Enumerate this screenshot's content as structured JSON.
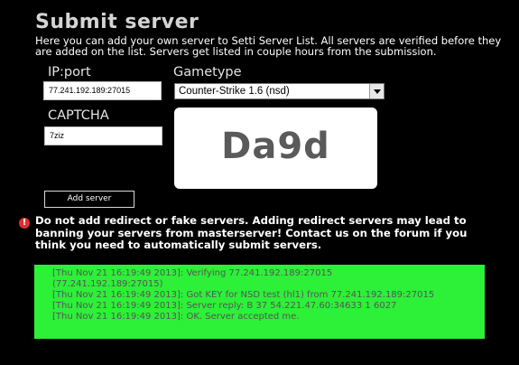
{
  "page": {
    "title": "Submit server",
    "intro": "Here you can add your own server to Setti Server List. All servers are verified before they are added on the list. Servers get listed in couple hours from the submission."
  },
  "form": {
    "ip_label": "IP:port",
    "ip_value": "77.241.192.189:27015",
    "gametype_label": "Gametype",
    "gametype_value": "Counter-Strike 1.6 (nsd)",
    "captcha_label": "CAPTCHA",
    "captcha_value": "7ziz",
    "captcha_image_text": "Da9d",
    "submit_label": "Add server"
  },
  "warning": {
    "icon": "exclamation-icon",
    "text": "Do not add redirect or fake servers. Adding redirect servers may lead to banning your servers from masterserver! Contact us on the forum if you think you need to automatically submit servers."
  },
  "log": {
    "lines": [
      "[Thu Nov 21 16:19:49 2013]: Verifying 77.241.192.189:27015",
      "(77.241.192.189:27015)",
      "[Thu Nov 21 16:19:49 2013]: Got KEY for NSD test (hl1) from 77.241.192.189:27015",
      "[Thu Nov 21 16:19:49 2013]: Server reply: B 37 54.221.47.60:34633 1 6027",
      "[Thu Nov 21 16:19:49 2013]: OK. Server accepted me."
    ]
  },
  "colors": {
    "background": "#000000",
    "log_background": "#2df039",
    "title": "#d4d4d4",
    "warning_icon": "#e03030"
  }
}
